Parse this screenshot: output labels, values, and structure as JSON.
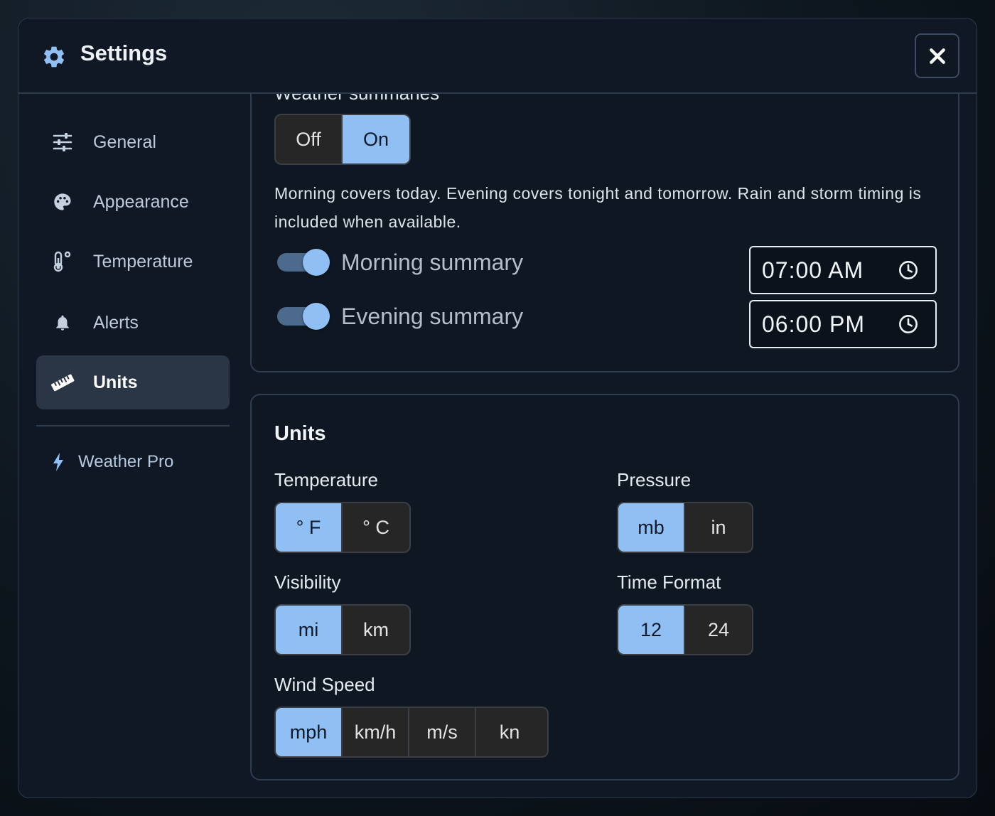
{
  "header": {
    "title": "Settings",
    "close_label": "✕"
  },
  "sidebar": {
    "items": [
      {
        "label": "General",
        "icon": "sliders-icon",
        "active": false
      },
      {
        "label": "Appearance",
        "icon": "palette-icon",
        "active": false
      },
      {
        "label": "Temperature",
        "icon": "thermometer-icon",
        "active": false
      },
      {
        "label": "Alerts",
        "icon": "bell-icon",
        "active": false
      },
      {
        "label": "Units",
        "icon": "ruler-icon",
        "active": true
      }
    ],
    "pro": {
      "label": "Weather Pro",
      "icon": "bolt-icon"
    }
  },
  "summaries": {
    "heading": "Weather summaries",
    "toggle": {
      "options": [
        "Off",
        "On"
      ],
      "selected": "On"
    },
    "description": "Morning covers today. Evening covers tonight and tomorrow. Rain and storm timing is included when available.",
    "morning": {
      "label": "Morning summary",
      "enabled": true,
      "time": "07:00 AM"
    },
    "evening": {
      "label": "Evening summary",
      "enabled": true,
      "time": "06:00 PM"
    }
  },
  "units": {
    "title": "Units",
    "temperature": {
      "label": "Temperature",
      "options": [
        "° F",
        "° C"
      ],
      "selected": "° F"
    },
    "pressure": {
      "label": "Pressure",
      "options": [
        "mb",
        "in"
      ],
      "selected": "mb"
    },
    "visibility": {
      "label": "Visibility",
      "options": [
        "mi",
        "km"
      ],
      "selected": "mi"
    },
    "time_format": {
      "label": "Time Format",
      "options": [
        "12",
        "24"
      ],
      "selected": "12"
    },
    "wind_speed": {
      "label": "Wind Speed",
      "options": [
        "mph",
        "km/h",
        "m/s",
        "kn"
      ],
      "selected": "mph"
    }
  },
  "colors": {
    "accent": "#8fbff3",
    "panel_bg": "#0f1723",
    "modal_bg": "#101825",
    "active_nav_bg": "#2a3545"
  }
}
